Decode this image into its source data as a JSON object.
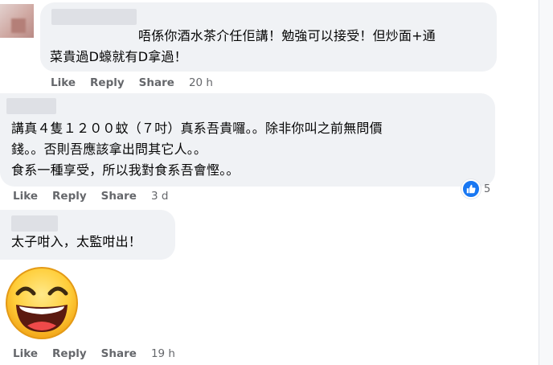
{
  "comments": [
    {
      "lines": [
        "唔係你酒水茶介任佢講！勉強可以接受！但炒面+通",
        "菜貴過D蠔就有D拿過！"
      ],
      "actions": {
        "like": "Like",
        "reply": "Reply",
        "share": "Share",
        "time": "20 h"
      }
    },
    {
      "lines": [
        "講真４隻１２００蚊（７吋）真系吾貴囉。。除非你叫之前無問價",
        "錢。。否則吾應該拿出問其它人。。",
        "食系一種享受，所以我對食系吾會慳。。"
      ],
      "actions": {
        "like": "Like",
        "reply": "Reply",
        "share": "Share",
        "time": "3 d"
      },
      "reaction_count": "5"
    },
    {
      "lines": [
        "太子咁入，太監咁出！"
      ],
      "actions": {
        "like": "Like",
        "reply": "Reply",
        "share": "Share",
        "time": "19 h"
      }
    }
  ],
  "icons": {
    "like_reaction": "thumbs-up-icon",
    "sticker": "laughing-face-emoji"
  },
  "colors": {
    "bubble": "#f0f2f5",
    "action_text": "#65676b",
    "like_blue": "#1877f2"
  }
}
